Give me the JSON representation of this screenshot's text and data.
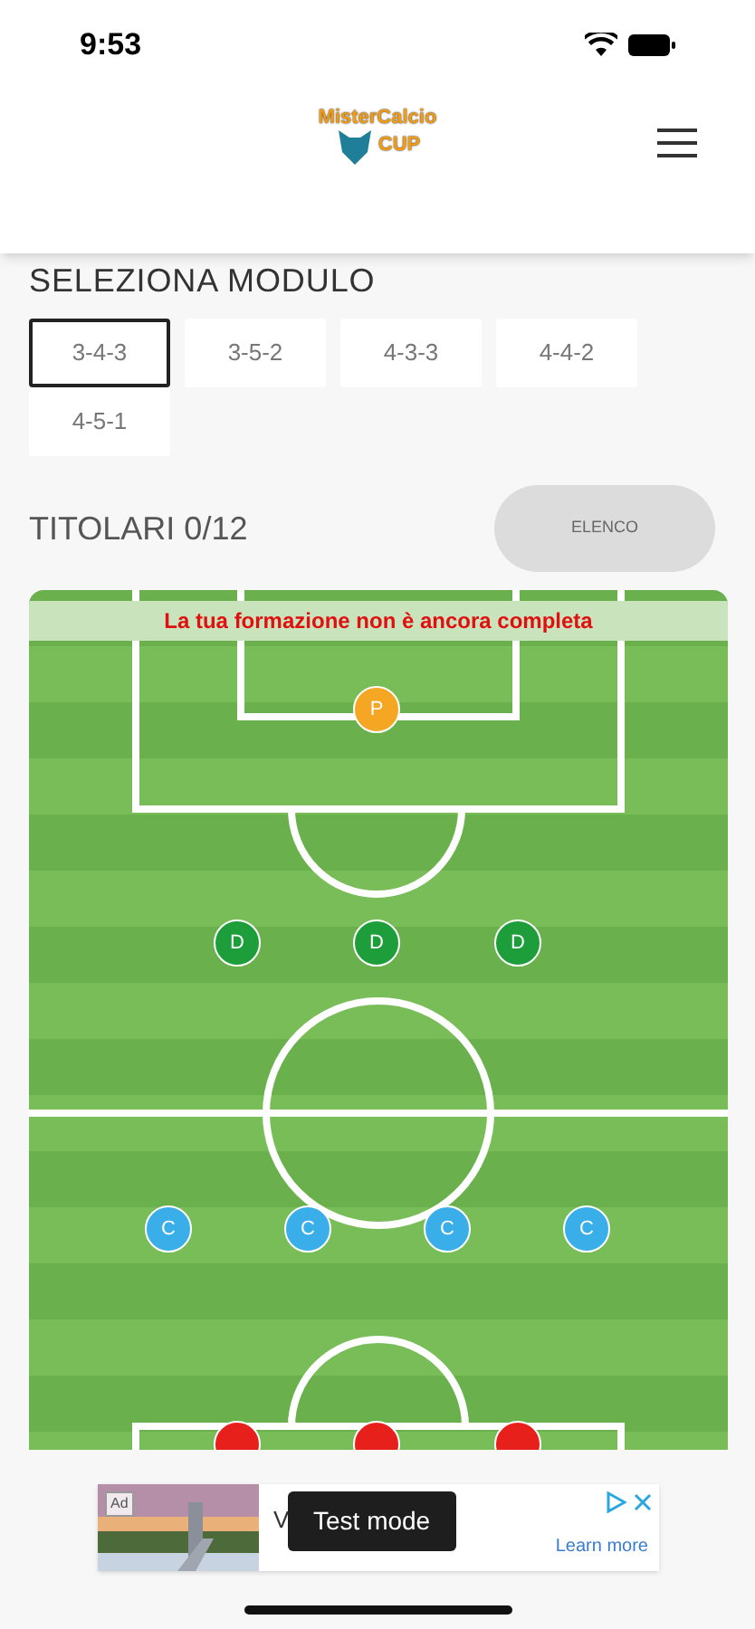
{
  "status_bar": {
    "time": "9:53"
  },
  "header": {
    "logo_text": "MisterCalcio",
    "logo_sub": "CUP"
  },
  "module_section": {
    "title": "SELEZIONA MODULO",
    "options": [
      {
        "label": "3-4-3",
        "selected": true
      },
      {
        "label": "3-5-2",
        "selected": false
      },
      {
        "label": "4-3-3",
        "selected": false
      },
      {
        "label": "4-4-2",
        "selected": false
      },
      {
        "label": "4-5-1",
        "selected": false
      }
    ]
  },
  "lineup": {
    "title": "TITOLARI 0/12",
    "button": "ELENCO"
  },
  "pitch": {
    "message": "La tua formazione non è ancora completa",
    "rows": [
      {
        "players": [
          {
            "label": "P",
            "color": "#f5a623"
          }
        ]
      },
      {
        "players": [
          {
            "label": "D",
            "color": "#1e9e3a"
          },
          {
            "label": "D",
            "color": "#1e9e3a"
          },
          {
            "label": "D",
            "color": "#1e9e3a"
          }
        ]
      },
      {
        "players": [
          {
            "label": "C",
            "color": "#3aaee8"
          },
          {
            "label": "C",
            "color": "#3aaee8"
          },
          {
            "label": "C",
            "color": "#3aaee8"
          },
          {
            "label": "C",
            "color": "#3aaee8"
          }
        ]
      },
      {
        "players": [
          {
            "color": "#e8201c"
          },
          {
            "color": "#e8201c"
          },
          {
            "color": "#e8201c"
          }
        ]
      }
    ]
  },
  "ad": {
    "badge": "Ad",
    "title": "V",
    "overlay": "Test mode",
    "link": "Learn more"
  }
}
